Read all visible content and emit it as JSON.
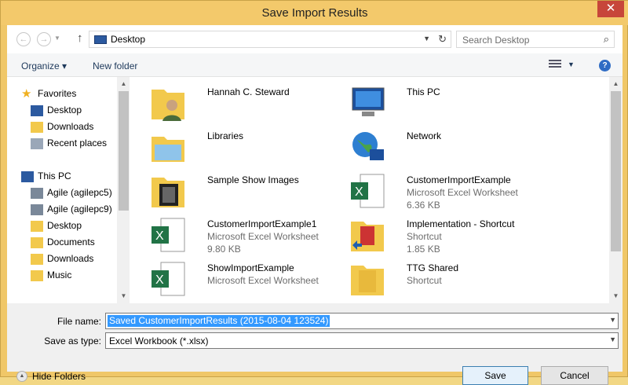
{
  "window": {
    "title": "Save Import Results",
    "close_label": "✕"
  },
  "address": {
    "location": "Desktop",
    "search_placeholder": "Search Desktop"
  },
  "toolbar": {
    "organize_label": "Organize ▾",
    "new_folder_label": "New folder",
    "help_label": "?"
  },
  "nav": {
    "favorites_label": "Favorites",
    "favorites": [
      {
        "label": "Desktop"
      },
      {
        "label": "Downloads"
      },
      {
        "label": "Recent places"
      }
    ],
    "thispc_label": "This PC",
    "thispc": [
      {
        "label": "Agile (agilepc5)"
      },
      {
        "label": "Agile (agilepc9)"
      },
      {
        "label": "Desktop"
      },
      {
        "label": "Documents"
      },
      {
        "label": "Downloads"
      },
      {
        "label": "Music"
      }
    ]
  },
  "items": [
    {
      "name": "Hannah C. Steward",
      "type": "",
      "size": "",
      "icon": "user-folder-icon"
    },
    {
      "name": "This PC",
      "type": "",
      "size": "",
      "icon": "computer-icon"
    },
    {
      "name": "Libraries",
      "type": "",
      "size": "",
      "icon": "libraries-icon"
    },
    {
      "name": "Network",
      "type": "",
      "size": "",
      "icon": "network-icon"
    },
    {
      "name": "Sample Show Images",
      "type": "",
      "size": "",
      "icon": "image-folder-icon"
    },
    {
      "name": "CustomerImportExample",
      "type": "Microsoft Excel Worksheet",
      "size": "6.36 KB",
      "icon": "excel-icon"
    },
    {
      "name": "CustomerImportExample1",
      "type": "Microsoft Excel Worksheet",
      "size": "9.80 KB",
      "icon": "excel-icon"
    },
    {
      "name": "Implementation - Shortcut",
      "type": "Shortcut",
      "size": "1.85 KB",
      "icon": "shortcut-folder-icon"
    },
    {
      "name": "ShowImportExample",
      "type": "Microsoft Excel Worksheet",
      "size": "",
      "icon": "excel-icon"
    },
    {
      "name": "TTG Shared",
      "type": "Shortcut",
      "size": "",
      "icon": "shortcut-folder-icon"
    }
  ],
  "form": {
    "file_name_label": "File name:",
    "file_name_value": "Saved CustomerImportResults (2015-08-04 123524)",
    "save_type_label": "Save as type:",
    "save_type_value": "Excel Workbook (*.xlsx)",
    "hide_folders_label": "Hide Folders",
    "save_label": "Save",
    "cancel_label": "Cancel"
  },
  "colors": {
    "title_bar": "#f3c96b",
    "close": "#c7463a",
    "selection": "#3399ff",
    "excel_green": "#217346",
    "folder": "#f2c94c"
  }
}
